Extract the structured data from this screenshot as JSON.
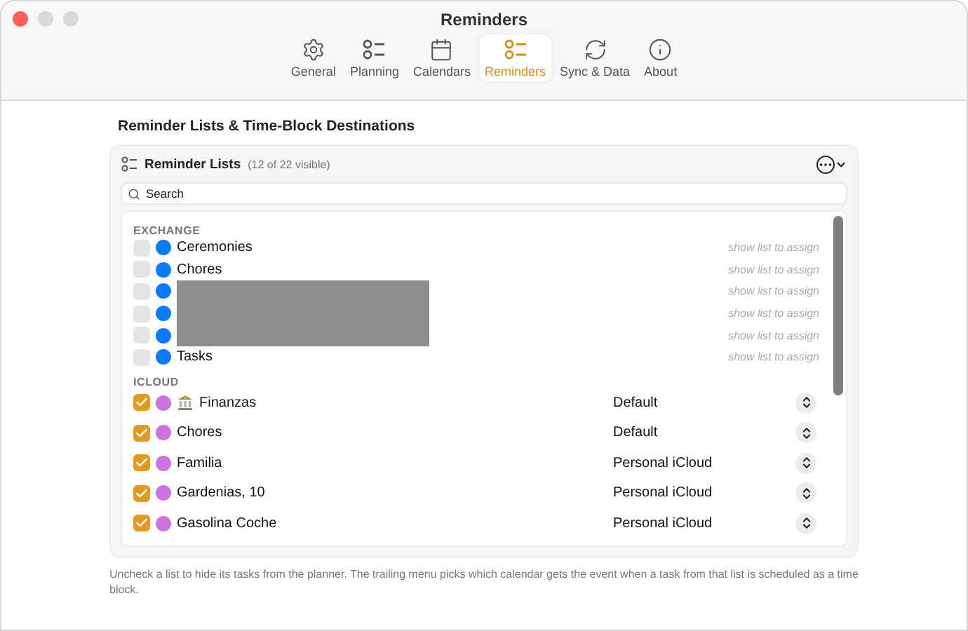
{
  "window": {
    "title": "Reminders"
  },
  "toolbar": [
    {
      "label": "General",
      "selected": false
    },
    {
      "label": "Planning",
      "selected": false
    },
    {
      "label": "Calendars",
      "selected": false
    },
    {
      "label": "Reminders",
      "selected": true
    },
    {
      "label": "Sync & Data",
      "selected": false
    },
    {
      "label": "About",
      "selected": false
    }
  ],
  "section_title": "Reminder Lists & Time-Block Destinations",
  "panel": {
    "title": "Reminder Lists",
    "count": "(12 of 22 visible)",
    "search": {
      "placeholder": "Search"
    },
    "groups": [
      {
        "name": "EXCHANGE",
        "rows": [
          {
            "name": "Ceremonies",
            "checked": false,
            "color": "#0a7aff",
            "hint": "show list to assign"
          },
          {
            "name": "Chores",
            "checked": false,
            "color": "#0a7aff",
            "hint": "show list to assign"
          },
          {
            "redacted": true,
            "checked": false,
            "color": "#0a7aff",
            "hint": "show list to assign"
          },
          {
            "redacted": true,
            "checked": false,
            "color": "#0a7aff",
            "hint": "show list to assign"
          },
          {
            "redacted": true,
            "checked": false,
            "color": "#0a7aff",
            "hint": "show list to assign"
          },
          {
            "name": "Tasks",
            "checked": false,
            "color": "#0a7aff",
            "hint": "show list to assign"
          }
        ]
      },
      {
        "name": "ICLOUD",
        "rows": [
          {
            "name": "Finanzas",
            "has_icon": true,
            "checked": true,
            "color": "#cc73e1",
            "destination": "Default"
          },
          {
            "name": "Chores",
            "checked": true,
            "color": "#cc73e1",
            "destination": "Default"
          },
          {
            "name": "Familia",
            "checked": true,
            "color": "#cc73e1",
            "destination": "Personal iCloud"
          },
          {
            "name": "Gardenias, 10",
            "checked": true,
            "color": "#cc73e1",
            "destination": "Personal iCloud"
          },
          {
            "name": "Gasolina Coche",
            "checked": true,
            "color": "#cc73e1",
            "destination": "Personal iCloud"
          }
        ]
      }
    ]
  },
  "footer": "Uncheck a list to hide its tasks from the planner. The trailing menu picks which calendar gets the event when a task from that list is scheduled as a time block."
}
